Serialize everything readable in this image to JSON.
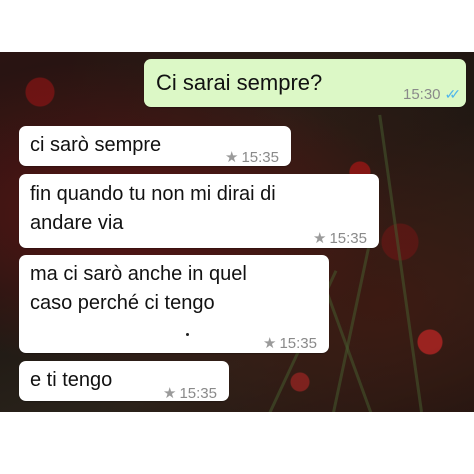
{
  "messages": [
    {
      "direction": "outgoing",
      "text": "Ci sarai sempre?",
      "time": "15:30",
      "status_icon": "double-check-read",
      "ticks": "✓✓"
    },
    {
      "direction": "incoming",
      "text": "ci sarò sempre",
      "time": "15:35",
      "starred": true,
      "star": "★"
    },
    {
      "direction": "incoming",
      "text": "fin quando tu non mi dirai di\nandare via",
      "time": "15:35",
      "starred": true,
      "star": "★"
    },
    {
      "direction": "incoming",
      "text": "ma ci sarò anche in quel\ncaso perché ci tengo",
      "time": "15:35",
      "starred": true,
      "star": "★"
    },
    {
      "direction": "incoming",
      "text": "e ti tengo",
      "time": "15:35",
      "starred": true,
      "star": "★"
    }
  ],
  "colors": {
    "outgoing_bubble": "#dcf8c6",
    "incoming_bubble": "#ffffff",
    "read_ticks": "#4fb6ec"
  }
}
